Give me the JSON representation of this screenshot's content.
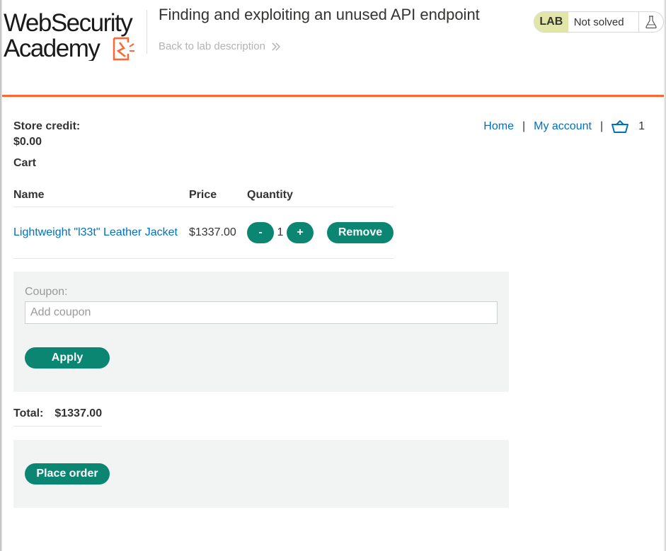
{
  "header": {
    "logo_line1": "WebSecurity",
    "logo_line2": "Academy",
    "lab_title": "Finding and exploiting an unused API endpoint",
    "back_link": "Back to lab description",
    "lab_badge": "LAB",
    "lab_status": "Not solved"
  },
  "store": {
    "credit_label": "Store credit:",
    "credit_value": "$0.00"
  },
  "nav": {
    "home": "Home",
    "sep1": "|",
    "my_account": "My account",
    "sep2": "|",
    "cart_count": "1"
  },
  "cart": {
    "heading": "Cart",
    "columns": [
      "Name",
      "Price",
      "Quantity"
    ],
    "items": [
      {
        "name": "Lightweight \"l33t\" Leather Jacket",
        "price": "$1337.00",
        "quantity": "1",
        "decrement_label": "-",
        "increment_label": "+",
        "remove_label": "Remove"
      }
    ]
  },
  "coupon": {
    "label": "Coupon:",
    "placeholder": "Add coupon",
    "value": "",
    "apply_label": "Apply"
  },
  "total": {
    "label": "Total:",
    "value": "$1337.00"
  },
  "order": {
    "place_order_label": "Place order"
  },
  "colors": {
    "accent_orange": "#ff6633",
    "button_green": "#0b8673",
    "link_blue": "#0071bc",
    "lab_badge_bg": "#e1e6a6",
    "panel_bg": "#f2f3f3"
  },
  "icons": {
    "back": "double-chevron-right-icon",
    "flask": "flask-icon",
    "cart": "basket-icon"
  }
}
